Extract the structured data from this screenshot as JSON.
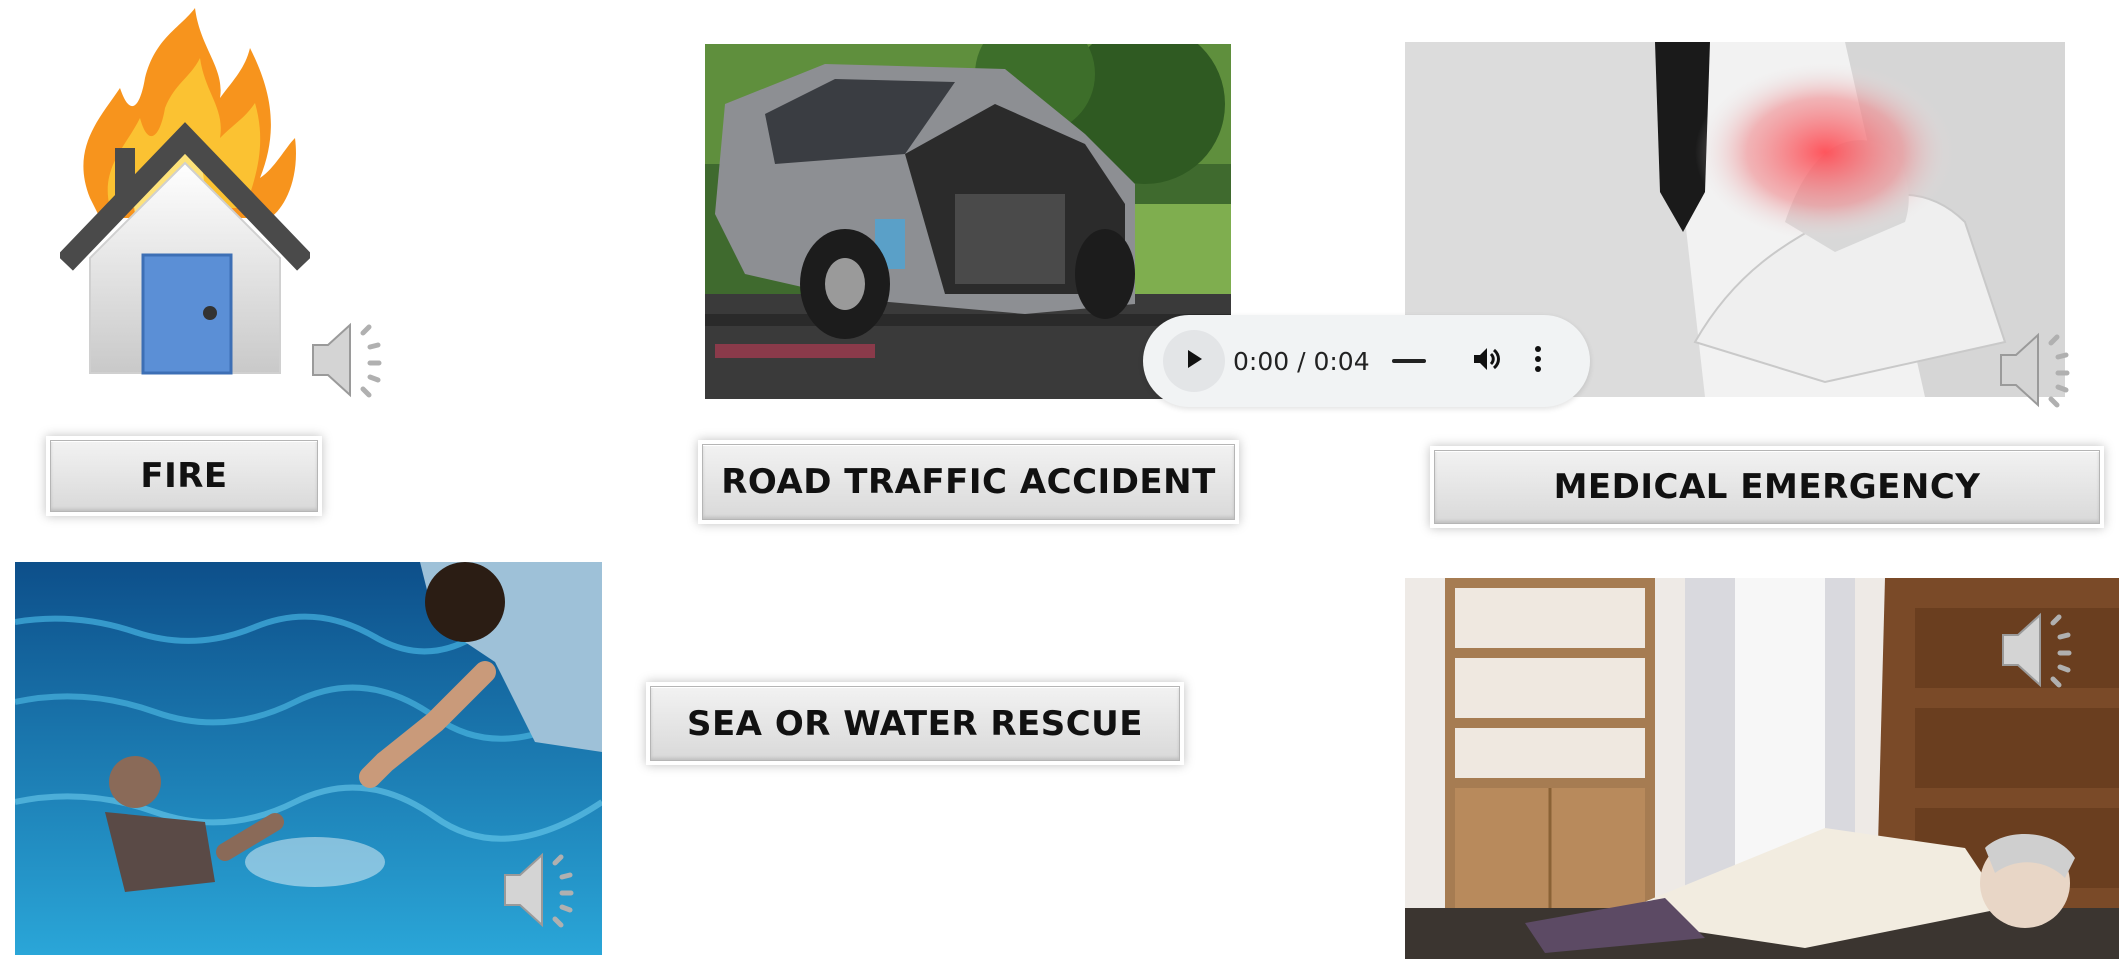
{
  "labels": {
    "fire": "FIRE",
    "road_traffic_accident": "ROAD TRAFFIC ACCIDENT",
    "medical_emergency": "MEDICAL EMERGENCY",
    "sea_or_water_rescue": "SEA OR WATER RESCUE"
  },
  "audio_player": {
    "time": "0:00 / 0:04"
  },
  "icons": {
    "fire_house": "burning-house-icon",
    "speaker": "speaker-icon",
    "play": "play-icon",
    "volume": "volume-icon",
    "menu": "more-vert-icon"
  },
  "colors": {
    "label_bg": "#dcdcdc",
    "player_bg": "#f1f3f4",
    "flame_orange": "#f7941d",
    "door_blue": "#5b8fd6",
    "water_blue": "#1e88b8"
  }
}
